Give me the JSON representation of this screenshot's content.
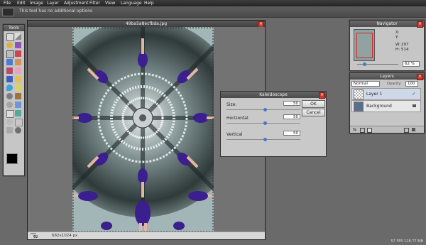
{
  "menu": [
    "File",
    "Edit",
    "Image",
    "Layer",
    "Adjustment",
    "Filter",
    "View",
    "Language",
    "Help"
  ],
  "options_bar": {
    "message": "This tool has no additional options"
  },
  "tools_panel": {
    "title": "Tools"
  },
  "document": {
    "title": "49ba5a8ecfbda.jpg",
    "zoom": "62",
    "zoom_unit": "%",
    "size": "682x1024 px"
  },
  "kaleidoscope": {
    "title": "Kaleidoscope",
    "ok_label": "OK",
    "cancel_label": "Cancel",
    "rows": [
      {
        "label": "Size:",
        "value": "50",
        "fraction": 0.5
      },
      {
        "label": "Horizontal",
        "value": "50",
        "fraction": 0.5
      },
      {
        "label": "Vertical",
        "value": "50",
        "fraction": 0.5
      }
    ]
  },
  "navigator": {
    "title": "Navigator",
    "x_label": "X:",
    "y_label": "Y:",
    "w_label": "W:",
    "w_value": "297",
    "h_label": "H:",
    "h_value": "514",
    "zoom": "62",
    "zoom_unit": "%"
  },
  "layers": {
    "title": "Layers",
    "blend_mode": "Normal",
    "opacity_label": "Opacity:",
    "opacity": "100",
    "items": [
      {
        "name": "Layer 1"
      },
      {
        "name": "Background"
      }
    ]
  },
  "footer": {
    "fps": "57 FPS 128.77 MB"
  },
  "colors": {
    "accent": "#4a78c0",
    "close": "#c8392b",
    "dress": "#3b1f8f"
  }
}
